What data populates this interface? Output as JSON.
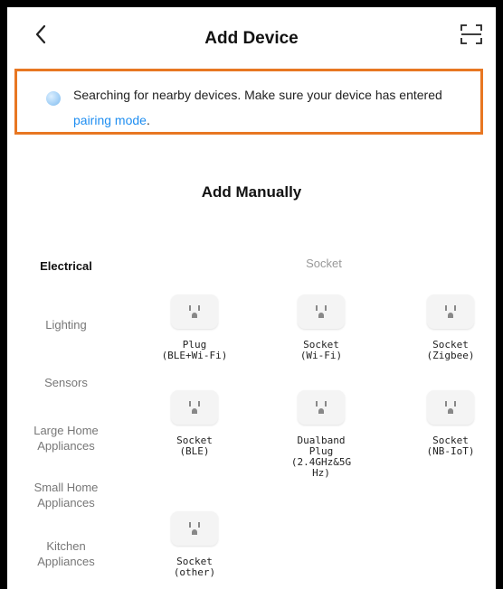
{
  "header": {
    "title": "Add Device",
    "back_icon": "chevron-left-icon",
    "scan_icon": "scan-icon"
  },
  "notice": {
    "text_before": "Searching for nearby devices. Make sure your device has entered ",
    "link": "pairing mode",
    "text_after": ".",
    "accent": "#e87722",
    "link_color": "#1f8ef1"
  },
  "section_title": "Add Manually",
  "categories": [
    "Electrical",
    "Lighting",
    "Sensors",
    "Large Home Appliances",
    "Small Home Appliances",
    "Kitchen Appliances"
  ],
  "active_category": "Electrical",
  "group_title": "Socket",
  "devices": [
    {
      "label": "Plug\n(BLE+Wi-Fi)",
      "icon": "socket-icon"
    },
    {
      "label": "Socket\n(Wi-Fi)",
      "icon": "socket-icon"
    },
    {
      "label": "Socket\n(Zigbee)",
      "icon": "socket-icon"
    },
    {
      "label": "Socket\n(BLE)",
      "icon": "socket-icon"
    },
    {
      "label": "Dualband\nPlug\n(2.4GHz&5G\nHz)",
      "icon": "socket-icon"
    },
    {
      "label": "Socket\n(NB-IoT)",
      "icon": "socket-icon"
    },
    {
      "label": "Socket\n(other)",
      "icon": "socket-icon"
    }
  ]
}
